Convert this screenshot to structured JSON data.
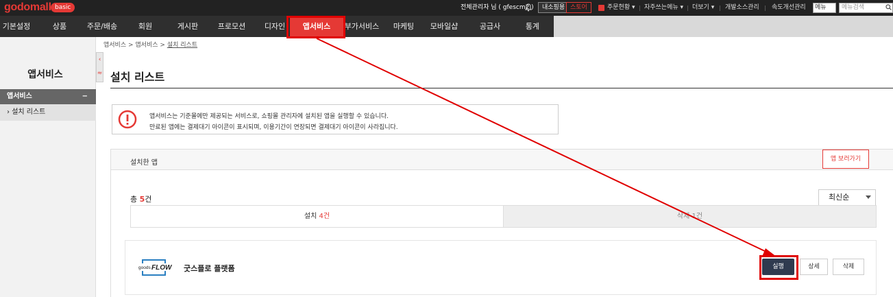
{
  "topbar": {
    "logo": "godomall",
    "badge": "basic",
    "admin_greeting": "전체관리자 님 ( gfescm2 )",
    "internal_btn": "내소핑용",
    "store_btn": "스토어",
    "links": [
      "주문현황 ▾",
      "자주쓰는메뉴 ▾",
      "더보기 ▾",
      "개발소스관리",
      "속도개선관리"
    ],
    "select_value": "메뉴",
    "search_placeholder": "메뉴검색"
  },
  "menubar": {
    "items": [
      "기본설정",
      "상품",
      "주문/배송",
      "회원",
      "게시판",
      "프로모션",
      "디자인",
      "앱서비스",
      "부가서비스",
      "마케팅",
      "모바일샵",
      "공급사",
      "통계"
    ],
    "active": "앱서비스"
  },
  "sidebar": {
    "title": "앱서비스",
    "section_label": "앱서비스",
    "collapse_symbol": "−",
    "item": "설치 리스트",
    "toggle_up": "‹",
    "toggle_down": "≈"
  },
  "breadcrumb": {
    "part1": "앱서비스",
    "part2": "앱서비스",
    "current": "설치 리스트"
  },
  "page": {
    "title": "설치 리스트",
    "notice_line1": "앱서비스는 기준몰에만 제공되는 서비스로, 쇼핑몰 관리자에 설치된 앱을 실행할 수 있습니다.",
    "notice_line2": "만료된 앱에는 결제대기 아이콘이 표시되며, 이용기간이 연장되면 결제대기 아이콘이 사라집니다."
  },
  "installed": {
    "header_label": "설치한 앱",
    "store_button": "앱 보러가기",
    "total_prefix": "총 ",
    "total_count": "5",
    "total_suffix": "건",
    "sort_value": "최신순",
    "tab_installed_prefix": "설치 ",
    "tab_installed_count": "4건",
    "tab_deleted": "삭제 1건"
  },
  "app": {
    "logo_small": "goods",
    "logo_big": "FLOW",
    "name": "굿스플로 플랫폼",
    "run_button": "실행",
    "detail_button": "상세",
    "delete_button": "삭제"
  },
  "colors": {
    "accent": "#e53935",
    "highlight": "#e00000",
    "dark_button": "#2f3a4f"
  }
}
